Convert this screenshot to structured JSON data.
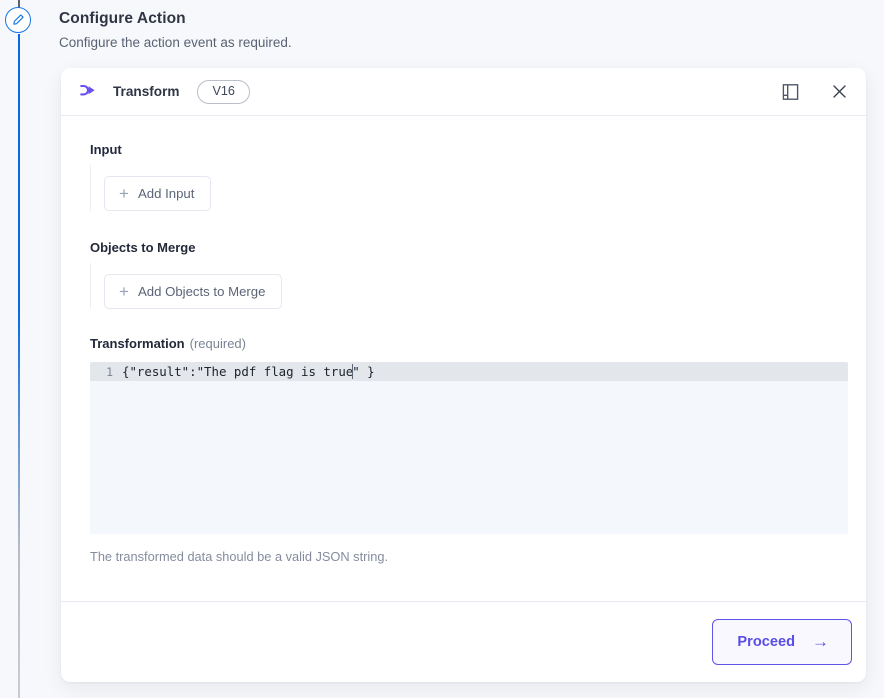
{
  "page": {
    "title": "Configure Action",
    "subtitle": "Configure the action event as required."
  },
  "rail": {
    "node_icon": "pencil-icon"
  },
  "card": {
    "header": {
      "icon": "transform-icon",
      "title": "Transform",
      "version_badge": "V16",
      "docs_icon": "book-icon",
      "close_icon": "close-icon"
    },
    "fields": {
      "input": {
        "label": "Input",
        "add_button": "Add Input",
        "add_icon": "plus-icon"
      },
      "objects_to_merge": {
        "label": "Objects to Merge",
        "add_button": "Add Objects to Merge",
        "add_icon": "plus-icon"
      },
      "transformation": {
        "label": "Transformation",
        "required_text": "(required)",
        "line_number": "1",
        "code_before_caret": "{\"result\":\"The pdf flag is true",
        "code_after_caret": "\" }",
        "hint": "The transformed data should be a valid JSON string."
      }
    },
    "footer": {
      "proceed_label": "Proceed",
      "proceed_arrow": "→"
    }
  },
  "colors": {
    "accent_purple": "#5a4de6",
    "rail_blue": "#0a6ae4",
    "page_bg": "#f7f8fb",
    "card_bg": "#ffffff",
    "editor_bg": "#f4f7fc",
    "active_line": "#e3e6ea"
  }
}
